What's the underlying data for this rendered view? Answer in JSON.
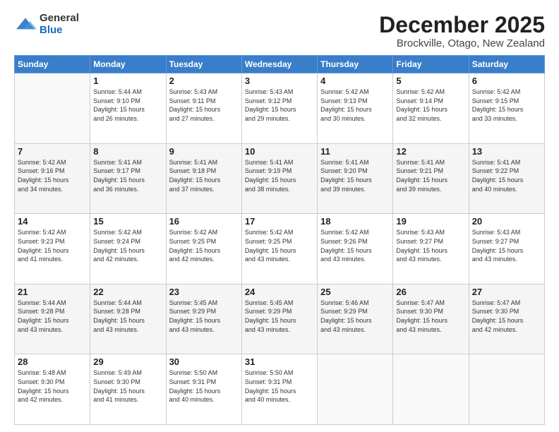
{
  "header": {
    "logo_general": "General",
    "logo_blue": "Blue",
    "title": "December 2025",
    "subtitle": "Brockville, Otago, New Zealand"
  },
  "weekdays": [
    "Sunday",
    "Monday",
    "Tuesday",
    "Wednesday",
    "Thursday",
    "Friday",
    "Saturday"
  ],
  "weeks": [
    [
      {
        "day": "",
        "info": ""
      },
      {
        "day": "1",
        "info": "Sunrise: 5:44 AM\nSunset: 9:10 PM\nDaylight: 15 hours\nand 26 minutes."
      },
      {
        "day": "2",
        "info": "Sunrise: 5:43 AM\nSunset: 9:11 PM\nDaylight: 15 hours\nand 27 minutes."
      },
      {
        "day": "3",
        "info": "Sunrise: 5:43 AM\nSunset: 9:12 PM\nDaylight: 15 hours\nand 29 minutes."
      },
      {
        "day": "4",
        "info": "Sunrise: 5:42 AM\nSunset: 9:13 PM\nDaylight: 15 hours\nand 30 minutes."
      },
      {
        "day": "5",
        "info": "Sunrise: 5:42 AM\nSunset: 9:14 PM\nDaylight: 15 hours\nand 32 minutes."
      },
      {
        "day": "6",
        "info": "Sunrise: 5:42 AM\nSunset: 9:15 PM\nDaylight: 15 hours\nand 33 minutes."
      }
    ],
    [
      {
        "day": "7",
        "info": "Sunrise: 5:42 AM\nSunset: 9:16 PM\nDaylight: 15 hours\nand 34 minutes."
      },
      {
        "day": "8",
        "info": "Sunrise: 5:41 AM\nSunset: 9:17 PM\nDaylight: 15 hours\nand 36 minutes."
      },
      {
        "day": "9",
        "info": "Sunrise: 5:41 AM\nSunset: 9:18 PM\nDaylight: 15 hours\nand 37 minutes."
      },
      {
        "day": "10",
        "info": "Sunrise: 5:41 AM\nSunset: 9:19 PM\nDaylight: 15 hours\nand 38 minutes."
      },
      {
        "day": "11",
        "info": "Sunrise: 5:41 AM\nSunset: 9:20 PM\nDaylight: 15 hours\nand 39 minutes."
      },
      {
        "day": "12",
        "info": "Sunrise: 5:41 AM\nSunset: 9:21 PM\nDaylight: 15 hours\nand 39 minutes."
      },
      {
        "day": "13",
        "info": "Sunrise: 5:41 AM\nSunset: 9:22 PM\nDaylight: 15 hours\nand 40 minutes."
      }
    ],
    [
      {
        "day": "14",
        "info": "Sunrise: 5:42 AM\nSunset: 9:23 PM\nDaylight: 15 hours\nand 41 minutes."
      },
      {
        "day": "15",
        "info": "Sunrise: 5:42 AM\nSunset: 9:24 PM\nDaylight: 15 hours\nand 42 minutes."
      },
      {
        "day": "16",
        "info": "Sunrise: 5:42 AM\nSunset: 9:25 PM\nDaylight: 15 hours\nand 42 minutes."
      },
      {
        "day": "17",
        "info": "Sunrise: 5:42 AM\nSunset: 9:25 PM\nDaylight: 15 hours\nand 43 minutes."
      },
      {
        "day": "18",
        "info": "Sunrise: 5:42 AM\nSunset: 9:26 PM\nDaylight: 15 hours\nand 43 minutes."
      },
      {
        "day": "19",
        "info": "Sunrise: 5:43 AM\nSunset: 9:27 PM\nDaylight: 15 hours\nand 43 minutes."
      },
      {
        "day": "20",
        "info": "Sunrise: 5:43 AM\nSunset: 9:27 PM\nDaylight: 15 hours\nand 43 minutes."
      }
    ],
    [
      {
        "day": "21",
        "info": "Sunrise: 5:44 AM\nSunset: 9:28 PM\nDaylight: 15 hours\nand 43 minutes."
      },
      {
        "day": "22",
        "info": "Sunrise: 5:44 AM\nSunset: 9:28 PM\nDaylight: 15 hours\nand 43 minutes."
      },
      {
        "day": "23",
        "info": "Sunrise: 5:45 AM\nSunset: 9:29 PM\nDaylight: 15 hours\nand 43 minutes."
      },
      {
        "day": "24",
        "info": "Sunrise: 5:45 AM\nSunset: 9:29 PM\nDaylight: 15 hours\nand 43 minutes."
      },
      {
        "day": "25",
        "info": "Sunrise: 5:46 AM\nSunset: 9:29 PM\nDaylight: 15 hours\nand 43 minutes."
      },
      {
        "day": "26",
        "info": "Sunrise: 5:47 AM\nSunset: 9:30 PM\nDaylight: 15 hours\nand 43 minutes."
      },
      {
        "day": "27",
        "info": "Sunrise: 5:47 AM\nSunset: 9:30 PM\nDaylight: 15 hours\nand 42 minutes."
      }
    ],
    [
      {
        "day": "28",
        "info": "Sunrise: 5:48 AM\nSunset: 9:30 PM\nDaylight: 15 hours\nand 42 minutes."
      },
      {
        "day": "29",
        "info": "Sunrise: 5:49 AM\nSunset: 9:30 PM\nDaylight: 15 hours\nand 41 minutes."
      },
      {
        "day": "30",
        "info": "Sunrise: 5:50 AM\nSunset: 9:31 PM\nDaylight: 15 hours\nand 40 minutes."
      },
      {
        "day": "31",
        "info": "Sunrise: 5:50 AM\nSunset: 9:31 PM\nDaylight: 15 hours\nand 40 minutes."
      },
      {
        "day": "",
        "info": ""
      },
      {
        "day": "",
        "info": ""
      },
      {
        "day": "",
        "info": ""
      }
    ]
  ]
}
